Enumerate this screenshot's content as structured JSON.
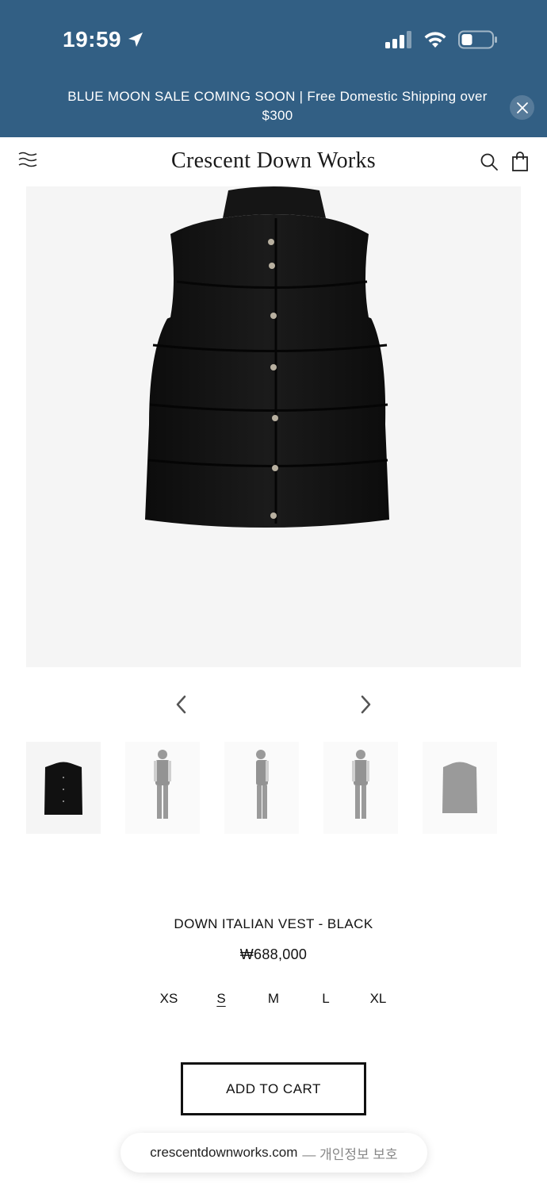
{
  "status_bar": {
    "time": "19:59",
    "icons": [
      "location-arrow-icon",
      "cellular-signal-icon",
      "wifi-icon",
      "battery-icon"
    ]
  },
  "announcement": {
    "text": "BLUE MOON SALE COMING SOON | Free Domestic Shipping over $300",
    "close_icon": "close-icon"
  },
  "header": {
    "brand": "Crescent Down Works",
    "icons": [
      "menu-icon",
      "search-icon",
      "bag-icon"
    ]
  },
  "gallery": {
    "main_image": "black-down-vest-photo",
    "prev_icon": "chevron-left-icon",
    "next_icon": "chevron-right-icon",
    "thumbnails": [
      "vest-front",
      "model-front",
      "model-side",
      "model-back",
      "vest-gray"
    ]
  },
  "product": {
    "title": "DOWN ITALIAN VEST - BLACK",
    "price": "₩688,000",
    "sizes": [
      "XS",
      "S",
      "M",
      "L",
      "XL"
    ],
    "selected_size": "S",
    "add_to_cart_label": "ADD TO CART"
  },
  "browser": {
    "domain": "crescentdownworks.com",
    "suffix": "— 개인정보 보호"
  },
  "colors": {
    "top_bar": "#325f84",
    "text": "#111111",
    "background": "#ffffff"
  }
}
